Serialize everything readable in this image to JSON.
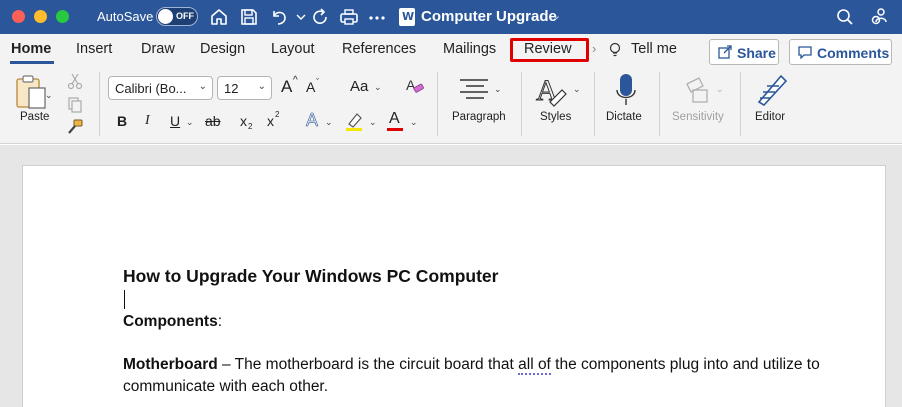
{
  "titlebar": {
    "autosave_label": "AutoSave",
    "autosave_state": "OFF",
    "doc_icon_letter": "W",
    "doc_title": "Computer Upgrade",
    "icons": [
      "home-icon",
      "save-icon",
      "undo-icon",
      "redo-icon",
      "print-icon",
      "more-icon",
      "search-icon",
      "share-people-icon"
    ]
  },
  "tabs": {
    "items": [
      {
        "label": "Home",
        "active": true
      },
      {
        "label": "Insert"
      },
      {
        "label": "Draw"
      },
      {
        "label": "Design"
      },
      {
        "label": "Layout"
      },
      {
        "label": "References"
      },
      {
        "label": "Mailings"
      },
      {
        "label": "Review",
        "highlighted": true
      }
    ],
    "tell_me": "Tell me",
    "share_label": "Share",
    "comments_label": "Comments"
  },
  "ribbon": {
    "paste_label": "Paste",
    "font_name": "Calibri (Bo...",
    "font_size": "12",
    "grow_font": "A",
    "shrink_font": "A",
    "change_case": "Aa",
    "bold": "B",
    "italic": "I",
    "underline": "U",
    "strikethrough": "ab",
    "subscript": "x",
    "subscript_mark": "2",
    "superscript": "x",
    "superscript_mark": "2",
    "text_effects": "A",
    "highlight_letter": "ab",
    "font_color_letter": "A",
    "paragraph_label": "Paragraph",
    "styles_label": "Styles",
    "dictate_label": "Dictate",
    "sensitivity_label": "Sensitivity",
    "editor_label": "Editor",
    "colors": {
      "highlight": "#f5e700",
      "font_color": "#e00000",
      "text_effects": "#2b579a"
    }
  },
  "document": {
    "heading": "How to Upgrade Your Windows PC Computer",
    "components_bold": "Components",
    "components_rest": ":",
    "para1_bold": "Motherboard",
    "para1_text_a": " – The motherboard is the circuit board that ",
    "para1_squiggle": "all of",
    "para1_text_b": " the components plug into and utilize to communicate with each other."
  },
  "theme": {
    "accent": "#2b579a",
    "highlight_box": "#e00000"
  }
}
